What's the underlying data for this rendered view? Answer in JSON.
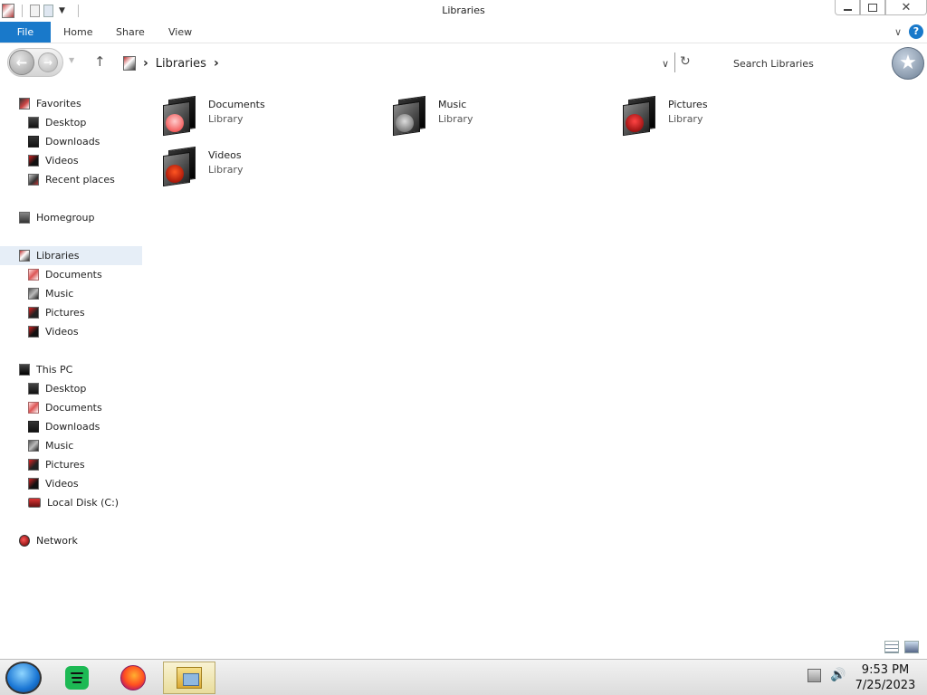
{
  "window": {
    "title": "Libraries"
  },
  "ribbon": {
    "tabs": [
      {
        "label": "File"
      },
      {
        "label": "Home"
      },
      {
        "label": "Share"
      },
      {
        "label": "View"
      }
    ]
  },
  "address": {
    "crumbs": [
      "Libraries"
    ],
    "search_placeholder": "Search Libraries"
  },
  "nav": {
    "favorites": {
      "label": "Favorites",
      "items": [
        "Desktop",
        "Downloads",
        "Videos",
        "Recent places"
      ]
    },
    "homegroup": {
      "label": "Homegroup"
    },
    "libraries": {
      "label": "Libraries",
      "items": [
        "Documents",
        "Music",
        "Pictures",
        "Videos"
      ]
    },
    "thispc": {
      "label": "This PC",
      "items": [
        "Desktop",
        "Documents",
        "Downloads",
        "Music",
        "Pictures",
        "Videos",
        "Local Disk (C:)"
      ]
    },
    "network": {
      "label": "Network"
    }
  },
  "content": {
    "libraries": [
      {
        "name": "Documents",
        "type": "Library"
      },
      {
        "name": "Music",
        "type": "Library"
      },
      {
        "name": "Pictures",
        "type": "Library"
      },
      {
        "name": "Videos",
        "type": "Library"
      }
    ]
  },
  "taskbar": {
    "apps": [
      "spotify-icon",
      "firefox-icon",
      "file-explorer-icon"
    ],
    "clock": {
      "time": "9:53 PM",
      "date": "7/25/2023"
    }
  },
  "colors": {
    "accent": "#1979ca",
    "selection": "#e6eef7"
  }
}
